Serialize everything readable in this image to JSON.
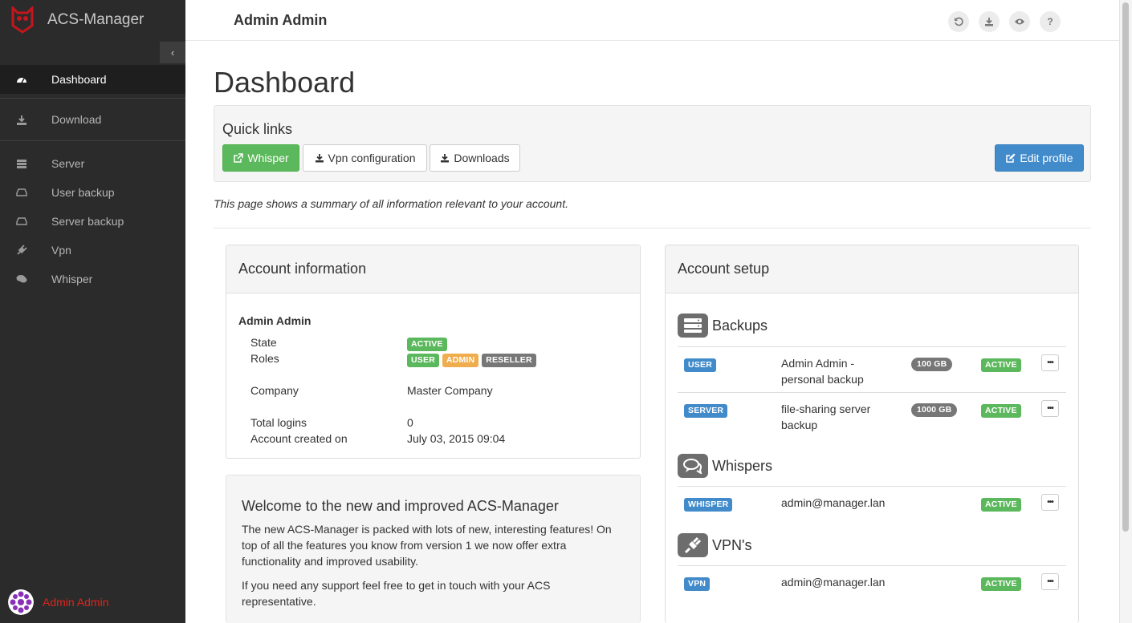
{
  "app": {
    "name": "ACS-Manager"
  },
  "sidebar": {
    "items": [
      {
        "label": "Dashboard",
        "icon": "dashboard-icon"
      },
      {
        "label": "Download",
        "icon": "download-icon"
      },
      {
        "label": "Server",
        "icon": "server-icon"
      },
      {
        "label": "User backup",
        "icon": "hdd-icon"
      },
      {
        "label": "Server backup",
        "icon": "hdd-icon"
      },
      {
        "label": "Vpn",
        "icon": "plug-icon"
      },
      {
        "label": "Whisper",
        "icon": "chat-icon"
      }
    ],
    "user_name": "Admin Admin"
  },
  "topbar": {
    "title": "Admin Admin"
  },
  "page": {
    "title": "Dashboard",
    "intro": "This page shows a summary of all information relevant to your account."
  },
  "quick_links": {
    "title": "Quick links",
    "whisper": "Whisper",
    "vpn": "Vpn configuration",
    "downloads": "Downloads",
    "edit_profile": "Edit profile"
  },
  "account": {
    "title": "Account information",
    "name": "Admin Admin",
    "state_label": "State",
    "state": "ACTIVE",
    "roles_label": "Roles",
    "roles": [
      "USER",
      "ADMIN",
      "RESELLER"
    ],
    "company_label": "Company",
    "company": "Master Company",
    "logins_label": "Total logins",
    "logins": "0",
    "created_label": "Account created on",
    "created": "July 03, 2015 09:04"
  },
  "welcome": {
    "title": "Welcome to the new and improved ACS-Manager",
    "p1": "The new ACS-Manager is packed with lots of new, interesting features! On top of all the features you know from version 1 we now offer extra functionality and improved usability.",
    "p2": "If you need any support feel free to get in touch with your ACS representative."
  },
  "setup": {
    "title": "Account setup",
    "backups_title": "Backups",
    "backups": [
      {
        "type": "USER",
        "name": "Admin Admin - personal backup",
        "size": "100 GB",
        "status": "ACTIVE",
        "action": "•••"
      },
      {
        "type": "SERVER",
        "name": "file-sharing server backup",
        "size": "1000 GB",
        "status": "ACTIVE",
        "action": "•••"
      }
    ],
    "whispers_title": "Whispers",
    "whispers": [
      {
        "type": "WHISPER",
        "name": "admin@manager.lan",
        "status": "ACTIVE",
        "action": "•••"
      }
    ],
    "vpns_title": "VPN's",
    "vpns": [
      {
        "type": "VPN",
        "name": "admin@manager.lan",
        "status": "ACTIVE",
        "action": "•••"
      }
    ]
  },
  "colors": {
    "sidebar_bg": "#2b2b2b",
    "success": "#5cb85c",
    "primary": "#428bca",
    "warning": "#f0ad4e",
    "brand_red": "#e0241b"
  }
}
